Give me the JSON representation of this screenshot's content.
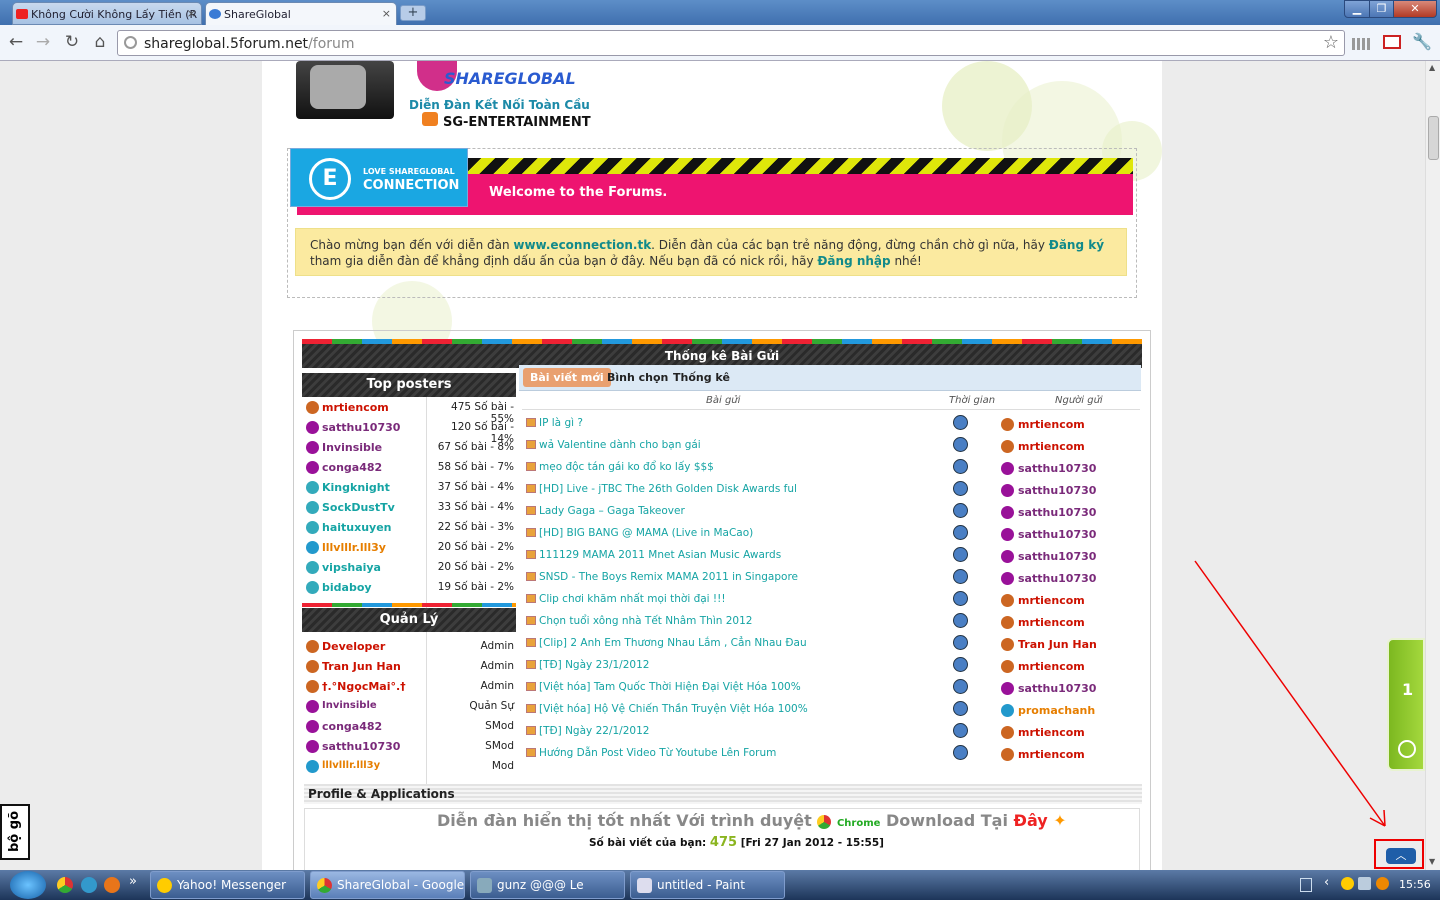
{
  "browser": {
    "tabs": [
      {
        "title": "Không Cười Không Lấy Tiền (R",
        "close": "×"
      },
      {
        "title": "ShareGlobal",
        "close": "×"
      }
    ],
    "new_tab": "+",
    "window_controls": {
      "minimize": "▁",
      "restore": "❐",
      "close": "✕"
    },
    "url_domain": "shareglobal.5forum.net",
    "url_path": "/forum"
  },
  "header": {
    "logo_text": "SHAREGLOBAL",
    "slogan": "Diễn Đàn Kết Nối Toàn Cầu",
    "section": "SG-ENTERTAINMENT"
  },
  "banner": {
    "small": "LOVE SHAREGLOBAL",
    "brand": "CONNECTION",
    "logo_letter": "E",
    "welcome": "Welcome to the Forums."
  },
  "notice": {
    "t1": "Chào mừng bạn đến với diễn đàn ",
    "link1": "www.econnection.tk",
    "t2": ". Diễn đàn của các bạn trẻ năng động, đừng chần chờ gì nữa, hãy ",
    "link2": "Đăng ký",
    "t3": " tham gia diễn đàn để khẳng định dấu ấn của bạn ở đây. Nếu bạn đã có nick rồi, hãy ",
    "link3": "Đăng nhập",
    "t4": " nhé!"
  },
  "stats": {
    "title": "Thống kê Bài Gửi",
    "top_posters_title": "Top posters",
    "top_posters": [
      {
        "name": "mrtiencom",
        "count": "475 Số bài - 55%",
        "color": "#cc1100",
        "icon": "#c62"
      },
      {
        "name": "satthu10730",
        "count": "120 Số bài - 14%",
        "color": "#7a2a7a",
        "icon": "#919"
      },
      {
        "name": "Invinsible",
        "count": "67 Số bài - 8%",
        "color": "#7a2a7a",
        "icon": "#919"
      },
      {
        "name": "conga482",
        "count": "58 Số bài - 7%",
        "color": "#7a2a7a",
        "icon": "#919"
      },
      {
        "name": "Kingknight",
        "count": "37 Số bài - 4%",
        "color": "#15a4a4",
        "icon": "#3ab"
      },
      {
        "name": "SockDustTv",
        "count": "33 Số bài - 4%",
        "color": "#15a4a4",
        "icon": "#3ab"
      },
      {
        "name": "haituxuyen",
        "count": "22 Số bài - 3%",
        "color": "#15a4a4",
        "icon": "#3ab"
      },
      {
        "name": "lllvlllr.lll3y",
        "count": "20 Số bài - 2%",
        "color": "#e67e00",
        "icon": "#29c"
      },
      {
        "name": "vipshaiya",
        "count": "20 Số bài - 2%",
        "color": "#15a4a4",
        "icon": "#3ab"
      },
      {
        "name": "bidaboy",
        "count": "19 Số bài - 2%",
        "color": "#15a4a4",
        "icon": "#3ab"
      }
    ],
    "admins_title": "Quản Lý",
    "admins": [
      {
        "name": "Developer",
        "role": "Admin",
        "color": "#cc1100",
        "icon": "#c62"
      },
      {
        "name": "Tran Jun Han",
        "role": "Admin",
        "color": "#cc1100",
        "icon": "#c62"
      },
      {
        "name": "†.°NgọcMai°.†",
        "role": "Admin",
        "color": "#cc1100",
        "icon": "#c62"
      },
      {
        "name": "Invinsible",
        "role": "Quản Sự",
        "color": "#7a2a7a",
        "icon": "#919"
      },
      {
        "name": "conga482",
        "role": "SMod",
        "color": "#7a2a7a",
        "icon": "#919"
      },
      {
        "name": "satthu10730",
        "role": "SMod",
        "color": "#7a2a7a",
        "icon": "#919"
      },
      {
        "name": "lllvlllr.lll3y",
        "role": "Mod",
        "color": "#e67e00",
        "icon": "#29c"
      }
    ],
    "tabs": [
      "Bài viết mới",
      "Bình chọn",
      "Thống kê"
    ],
    "col_post": "Bài gửi",
    "col_time": "Thời gian",
    "col_author": "Người gửi",
    "posts": [
      {
        "title": "IP là gì ?",
        "author": "mrtiencom",
        "color": "#cc1100",
        "icon": "#c62"
      },
      {
        "title": "wả Valentine dành cho bạn gái",
        "author": "mrtiencom",
        "color": "#cc1100",
        "icon": "#c62"
      },
      {
        "title": "mẹo độc tán gái ko đổ ko lấy $$$",
        "author": "satthu10730",
        "color": "#7a2a7a",
        "icon": "#919"
      },
      {
        "title": "[HD] Live - jTBC The 26th Golden Disk Awards ful",
        "author": "satthu10730",
        "color": "#7a2a7a",
        "icon": "#919"
      },
      {
        "title": "Lady Gaga – Gaga Takeover",
        "author": "satthu10730",
        "color": "#7a2a7a",
        "icon": "#919"
      },
      {
        "title": "[HD] BIG BANG @ MAMA (Live in MaCao)",
        "author": "satthu10730",
        "color": "#7a2a7a",
        "icon": "#919"
      },
      {
        "title": "111129 MAMA 2011 Mnet Asian Music Awards",
        "author": "satthu10730",
        "color": "#7a2a7a",
        "icon": "#919"
      },
      {
        "title": "SNSD - The Boys Remix MAMA 2011 in Singapore",
        "author": "satthu10730",
        "color": "#7a2a7a",
        "icon": "#919"
      },
      {
        "title": "Clip chơi khăm nhất mọi thời đại !!!",
        "author": "mrtiencom",
        "color": "#cc1100",
        "icon": "#c62"
      },
      {
        "title": "Chọn tuổi xông nhà Tết Nhâm Thìn 2012",
        "author": "mrtiencom",
        "color": "#cc1100",
        "icon": "#c62"
      },
      {
        "title": "[Clip] 2 Anh Em Thương Nhau Lắm , Cẳn Nhau Đau",
        "author": "Tran Jun Han",
        "color": "#cc1100",
        "icon": "#c62"
      },
      {
        "title": "[TĐ] Ngày 23/1/2012",
        "author": "mrtiencom",
        "color": "#cc1100",
        "icon": "#c62"
      },
      {
        "title": "[Việt hóa] Tam Quốc Thời Hiện Đại Việt Hóa 100%",
        "author": "satthu10730",
        "color": "#7a2a7a",
        "icon": "#919"
      },
      {
        "title": "[Việt hóa] Hộ Vệ Chiến Thần Truyện Việt Hóa 100%",
        "author": "promachanh",
        "color": "#e67e00",
        "icon": "#29c"
      },
      {
        "title": "[TĐ] Ngày 22/1/2012",
        "author": "mrtiencom",
        "color": "#cc1100",
        "icon": "#c62"
      },
      {
        "title": "Hướng Dẫn Post Video Từ Youtube Lên Forum",
        "author": "mrtiencom",
        "color": "#cc1100",
        "icon": "#c62"
      }
    ]
  },
  "profile": {
    "title": "Profile & Applications",
    "browser_text": "Diễn đàn hiển thị tốt nhất Với trình duyệt",
    "chrome": "Chrome",
    "download": "Download Tại",
    "here": "Đây",
    "posts_label": "Số bài viết của bạn:",
    "posts_value": "475",
    "date": "[Fri 27 Jan 2012 - 15:55]"
  },
  "side": {
    "green_number": "1",
    "bogo": "bộ gõ",
    "up": "︿"
  },
  "taskbar": {
    "items": [
      "Yahoo! Messenger",
      "ShareGlobal - Google ...",
      "gunz @@@ Le",
      "untitled - Paint"
    ],
    "more": "»",
    "clock": "15:56"
  }
}
